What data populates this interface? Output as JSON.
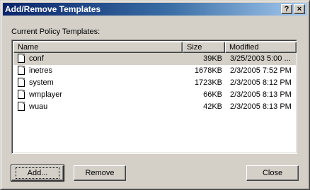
{
  "window": {
    "title": "Add/Remove Templates",
    "help_glyph": "?",
    "close_glyph": "×"
  },
  "section_label": "Current Policy Templates:",
  "list": {
    "columns": [
      "Name",
      "Size",
      "Modified"
    ],
    "rows": [
      {
        "name": "conf",
        "size": "39KB",
        "modified": "3/25/2003 5:00 ...",
        "selected": true
      },
      {
        "name": "inetres",
        "size": "1678KB",
        "modified": "2/3/2005 7:52 PM",
        "selected": false
      },
      {
        "name": "system",
        "size": "1723KB",
        "modified": "2/3/2005 8:12 PM",
        "selected": false
      },
      {
        "name": "wmplayer",
        "size": "66KB",
        "modified": "2/3/2005 8:13 PM",
        "selected": false
      },
      {
        "name": "wuau",
        "size": "42KB",
        "modified": "2/3/2005 8:13 PM",
        "selected": false
      }
    ]
  },
  "buttons": {
    "add": "Add...",
    "remove": "Remove",
    "close": "Close"
  },
  "colors": {
    "face": "#d4d0c8",
    "titlebar_start": "#0a246a",
    "titlebar_end": "#a6caf0",
    "selection": "#d4d0c8"
  },
  "icons": [
    "help-icon",
    "close-icon",
    "template-file-icon"
  ]
}
